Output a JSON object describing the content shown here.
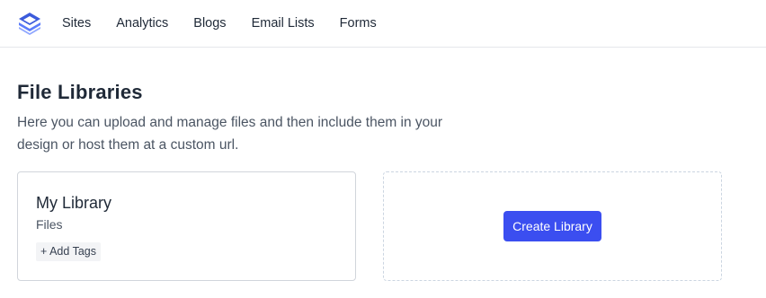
{
  "nav": {
    "logo_icon": "layered-stack-logo",
    "items": [
      {
        "label": "Sites"
      },
      {
        "label": "Analytics"
      },
      {
        "label": "Blogs"
      },
      {
        "label": "Email Lists"
      },
      {
        "label": "Forms"
      }
    ]
  },
  "page": {
    "title": "File Libraries",
    "description": "Here you can upload and manage files and then include them in your design or host them at a custom url."
  },
  "libraries": [
    {
      "name": "My Library",
      "subtitle": "Files",
      "add_tags_label": "+ Add Tags"
    }
  ],
  "create": {
    "button_label": "Create Library"
  },
  "colors": {
    "accent": "#3b4ef0",
    "logo": "#3b5bdb",
    "border": "#d1d5db"
  }
}
